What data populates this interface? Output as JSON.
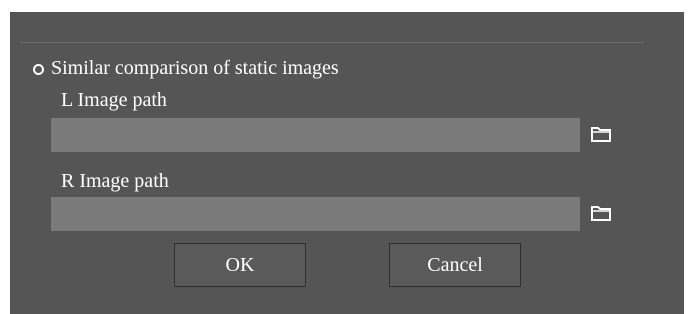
{
  "dialog": {
    "close_glyph": "×",
    "option_label": "Similar comparison of static images",
    "left_label": "L Image path",
    "left_value": "",
    "right_label": "R Image path",
    "right_value": "",
    "ok_label": "OK",
    "cancel_label": "Cancel"
  },
  "icons": {
    "close": "close-icon",
    "radio": "radio-icon",
    "browse": "folder-icon"
  },
  "colors": {
    "dialog_bg": "#555555",
    "input_bg": "#7a7a7a",
    "text": "#ffffff"
  }
}
